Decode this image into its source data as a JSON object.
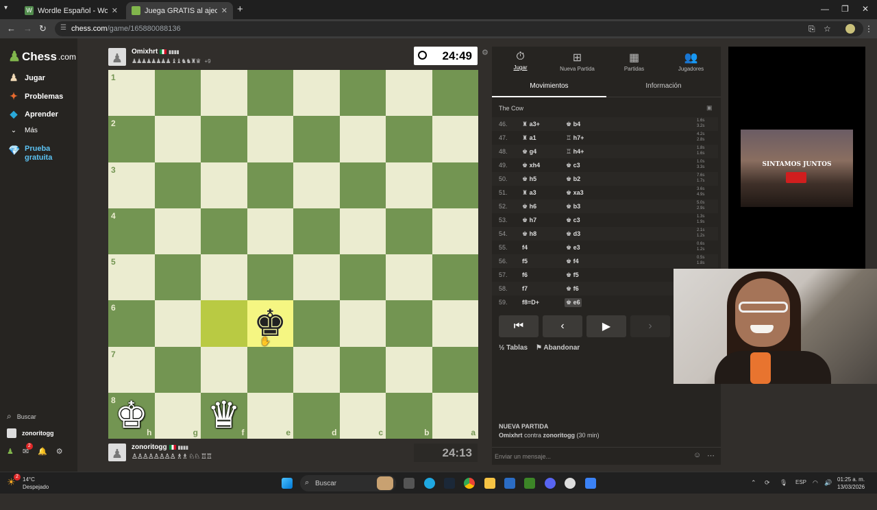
{
  "browser": {
    "tabs": [
      {
        "title": "Wordle Español - Wordle ilimita",
        "favicon_color": "#538d4e",
        "active": false
      },
      {
        "title": "Juega GRATIS al ajedrez online",
        "favicon_color": "#81b64c",
        "active": true
      }
    ],
    "url_domain": "chess.com",
    "url_path": "/game/165880088136"
  },
  "sidebar": {
    "logo": "Chess",
    "logo_suffix": ".com",
    "items": [
      {
        "label": "Jugar",
        "icon": "play-pawn-icon"
      },
      {
        "label": "Problemas",
        "icon": "puzzle-icon"
      },
      {
        "label": "Aprender",
        "icon": "graduation-cap-icon"
      },
      {
        "label": "Más",
        "icon": "chevron-down-icon"
      }
    ],
    "trial_line1": "Prueba",
    "trial_line2": "gratuita",
    "search_label": "Buscar",
    "username": "zonoritogg",
    "notification_badge": "2"
  },
  "top_player": {
    "name": "Omixhrt",
    "material_plus": "+9",
    "clock": "24:49"
  },
  "bottom_player": {
    "name": "zonoritogg",
    "clock": "24:13"
  },
  "board": {
    "light_color": "#ebecd0",
    "dark_color": "#739552",
    "ranks": [
      "1",
      "2",
      "3",
      "4",
      "5",
      "6",
      "7",
      "8"
    ],
    "files": [
      "h",
      "g",
      "f",
      "e",
      "d",
      "c",
      "b",
      "a"
    ],
    "pieces": [
      {
        "square": "e6",
        "piece": "♚",
        "color": "black"
      },
      {
        "square": "h8",
        "piece": "♚",
        "color": "white"
      },
      {
        "square": "f8",
        "piece": "♛",
        "color": "white"
      }
    ],
    "highlight_squares": [
      "f6",
      "e6"
    ]
  },
  "right_panel": {
    "tabs": [
      {
        "label": "Jugar",
        "icon": "stopwatch-icon"
      },
      {
        "label": "Nueva Partida",
        "icon": "plus-square-icon"
      },
      {
        "label": "Partidas",
        "icon": "chessboard-icon"
      },
      {
        "label": "Jugadores",
        "icon": "players-icon"
      }
    ],
    "subtabs": [
      "Movimientos",
      "Información"
    ],
    "opening": "The Cow",
    "moves": [
      {
        "n": "46.",
        "w": "a3+",
        "wp": "♜",
        "b": "b4",
        "bp": "♚",
        "t1": "1.6s",
        "t2": "3.2s"
      },
      {
        "n": "47.",
        "w": "a1",
        "wp": "♜",
        "b": "h7+",
        "bp": "♖",
        "t1": "4.2s",
        "t2": "2.8s"
      },
      {
        "n": "48.",
        "w": "g4",
        "wp": "♚",
        "b": "h4+",
        "bp": "♖",
        "t1": "1.8s",
        "t2": "1.6s"
      },
      {
        "n": "49.",
        "w": "xh4",
        "wp": "♚",
        "b": "c3",
        "bp": "♚",
        "t1": "1.0s",
        "t2": "3.3s"
      },
      {
        "n": "50.",
        "w": "h5",
        "wp": "♚",
        "b": "b2",
        "bp": "♚",
        "t1": "7.6s",
        "t2": "1.7s"
      },
      {
        "n": "51.",
        "w": "a3",
        "wp": "♜",
        "b": "xa3",
        "bp": "♚",
        "t1": "3.6s",
        "t2": "4.9s"
      },
      {
        "n": "52.",
        "w": "h6",
        "wp": "♚",
        "b": "b3",
        "bp": "♚",
        "t1": "5.0s",
        "t2": "2.9s"
      },
      {
        "n": "53.",
        "w": "h7",
        "wp": "♚",
        "b": "c3",
        "bp": "♚",
        "t1": "1.3s",
        "t2": "1.9s"
      },
      {
        "n": "54.",
        "w": "h8",
        "wp": "♚",
        "b": "d3",
        "bp": "♚",
        "t1": "2.1s",
        "t2": "1.2s"
      },
      {
        "n": "55.",
        "w": "f4",
        "wp": "",
        "b": "e3",
        "bp": "♚",
        "t1": "0.6s",
        "t2": "1.2s"
      },
      {
        "n": "56.",
        "w": "f5",
        "wp": "",
        "b": "f4",
        "bp": "♚",
        "t1": "0.5s",
        "t2": "1.8s"
      },
      {
        "n": "57.",
        "w": "f6",
        "wp": "",
        "b": "f5",
        "bp": "♚",
        "t1": "",
        "t2": ""
      },
      {
        "n": "58.",
        "w": "f7",
        "wp": "",
        "b": "f6",
        "bp": "♚",
        "t1": "",
        "t2": ""
      },
      {
        "n": "59.",
        "w": "f8=D+",
        "wp": "",
        "b": "e6",
        "bp": "♚",
        "t1": "",
        "t2": ""
      }
    ],
    "draw_icon": "½",
    "draw_label": "Tablas",
    "resign_label": "Abandonar",
    "new_game_title": "NUEVA PARTIDA",
    "new_game_desc_bold1": "Omixhrt",
    "new_game_desc_mid": " contra ",
    "new_game_desc_bold2": "zonoritogg",
    "new_game_desc_tail": " (30 min)",
    "chat_placeholder": "Enviar un mensaje..."
  },
  "ad": {
    "text": "SINTAMOS JUNTOS"
  },
  "taskbar": {
    "temp": "14°C",
    "weather": "Despejado",
    "weather_badge": "2",
    "search": "Buscar",
    "lang": "ESP",
    "time": "01:25 a. m.",
    "date": "13/03/2026"
  }
}
